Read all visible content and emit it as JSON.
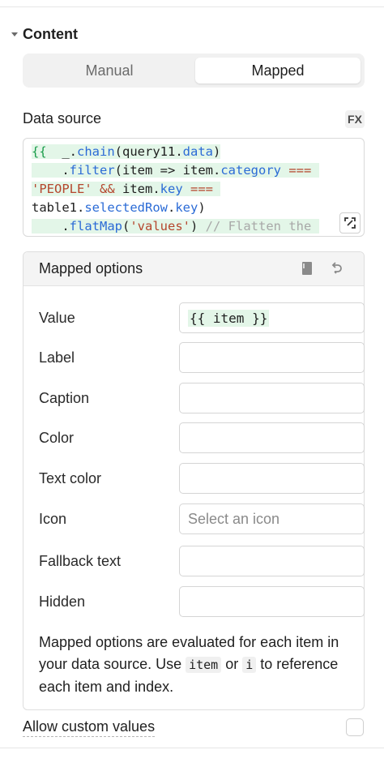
{
  "section": {
    "title": "Content"
  },
  "mode_toggle": {
    "options": [
      "Manual",
      "Mapped"
    ],
    "selected": "Mapped"
  },
  "data_source": {
    "label": "Data source",
    "fx_badge": "FX",
    "code_lines": [
      "{{ _.chain(query11.data)",
      "    .filter(item => item.category ===",
      "'PEOPLE' && item.key ===",
      "table1.selectedRow.key)",
      "    .flatMap('values') // Flatten the"
    ]
  },
  "mapped_options": {
    "title": "Mapped options",
    "fields": [
      {
        "label": "Value",
        "value": "{{ item }}",
        "placeholder": ""
      },
      {
        "label": "Label",
        "value": "",
        "placeholder": ""
      },
      {
        "label": "Caption",
        "value": "",
        "placeholder": ""
      },
      {
        "label": "Color",
        "value": "",
        "placeholder": ""
      },
      {
        "label": "Text color",
        "value": "",
        "placeholder": ""
      },
      {
        "label": "Icon",
        "value": "",
        "placeholder": "Select an icon"
      },
      {
        "label": "Fallback text",
        "value": "",
        "placeholder": ""
      },
      {
        "label": "Hidden",
        "value": "",
        "placeholder": ""
      }
    ],
    "help": {
      "part1": "Mapped options are evaluated for each item in your data source. Use ",
      "code1": "item",
      "part2": " or ",
      "code2": "i",
      "part3": " to reference each item and index."
    }
  },
  "allow_custom_values": {
    "label": "Allow custom values",
    "checked": false
  },
  "colors": {
    "accent_green": "#1a9c4a",
    "highlight_green": "#e3f6e8",
    "property_blue": "#2b6bd6",
    "string_red": "#b5462d"
  },
  "icons": {
    "collapse": "caret-down-icon",
    "expand": "expand-icon",
    "docs": "book-icon",
    "reset": "undo-icon"
  }
}
